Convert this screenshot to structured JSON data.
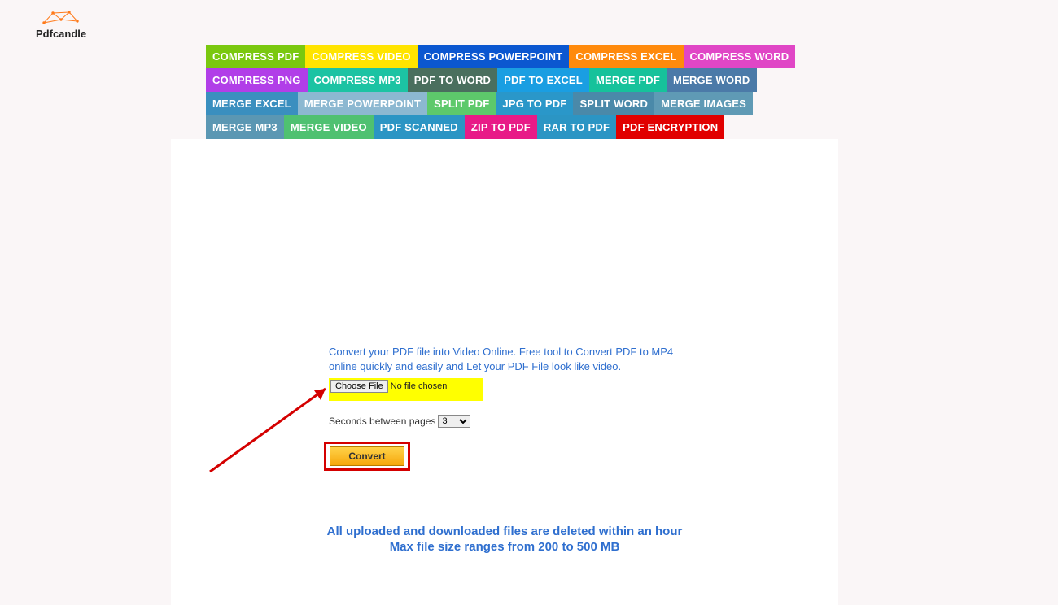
{
  "logo": {
    "text": "Pdfcandle"
  },
  "nav": [
    {
      "label": "COMPRESS PDF",
      "bg": "#7ac80f"
    },
    {
      "label": "COMPRESS VIDEO",
      "bg": "#ffe400"
    },
    {
      "label": "COMPRESS POWERPOINT",
      "bg": "#0b57d0"
    },
    {
      "label": "COMPRESS EXCEL",
      "bg": "#ff8a0c"
    },
    {
      "label": "COMPRESS WORD",
      "bg": "#e046c6"
    },
    {
      "label": "COMPRESS PNG",
      "bg": "#b13ee8"
    },
    {
      "label": "COMPRESS MP3",
      "bg": "#1cc3a3"
    },
    {
      "label": "PDF TO WORD",
      "bg": "#4a6f5e"
    },
    {
      "label": "PDF TO EXCEL",
      "bg": "#1a9ee2"
    },
    {
      "label": "MERGE PDF",
      "bg": "#16c29b"
    },
    {
      "label": "MERGE WORD",
      "bg": "#4b7aa8"
    },
    {
      "label": "MERGE EXCEL",
      "bg": "#3a8fbf"
    },
    {
      "label": "MERGE POWERPOINT",
      "bg": "#8cb8d1"
    },
    {
      "label": "SPLIT PDF",
      "bg": "#5dc96b"
    },
    {
      "label": "JPG TO PDF",
      "bg": "#2a97c9"
    },
    {
      "label": "SPLIT WORD",
      "bg": "#4a89a9"
    },
    {
      "label": "MERGE IMAGES",
      "bg": "#5f9ab5"
    },
    {
      "label": "MERGE MP3",
      "bg": "#5b97b3"
    },
    {
      "label": "MERGE VIDEO",
      "bg": "#4fc171"
    },
    {
      "label": "PDF SCANNED",
      "bg": "#2b95c4"
    },
    {
      "label": "ZIP TO PDF",
      "bg": "#e81a87"
    },
    {
      "label": "RAR TO PDF",
      "bg": "#2b95c4"
    },
    {
      "label": "PDF ENCRYPTION",
      "bg": "#e10000"
    }
  ],
  "description": "Convert your PDF file into Video Online. Free tool to Convert PDF to MP4 online quickly and easily and Let your PDF File look like video.",
  "file": {
    "choose_label": "Choose File",
    "status": "No file chosen"
  },
  "seconds": {
    "label": "Seconds between pages",
    "value": "3"
  },
  "convert_label": "Convert",
  "notice_line1": "All uploaded and downloaded files are deleted within an hour",
  "notice_line2": "Max file size ranges from 200 to 500 MB"
}
